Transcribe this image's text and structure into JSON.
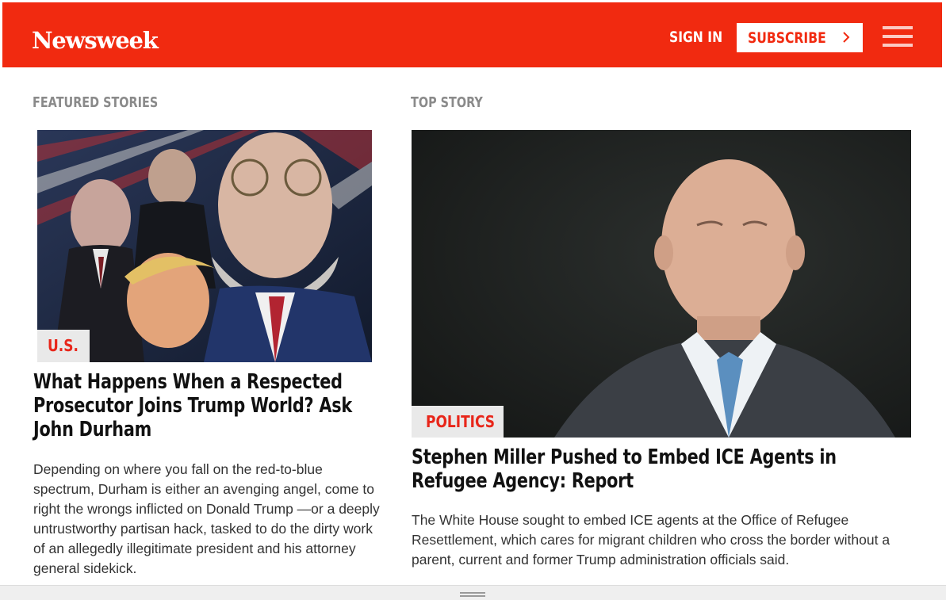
{
  "header": {
    "logo": "Newsweek",
    "sign_in": "SIGN IN",
    "subscribe": "SUBSCRIBE",
    "brand_color": "#f12a10"
  },
  "featured": {
    "section_label": "FEATURED STORIES",
    "tag": "U.S.",
    "headline": "What Happens When a Respected Prosecutor Joins Trump World? Ask John Durham",
    "summary": "Depending on where you fall on the red-to-blue spectrum, Durham is either an avenging angel, come to right the wrongs inflicted on Donald Trump —or a deeply untrustworthy partisan hack, tasked to do the dirty work of an allegedly illegitimate president and his attorney general sidekick."
  },
  "top_story": {
    "section_label": "TOP STORY",
    "tag": "POLITICS",
    "headline": "Stephen Miller Pushed to Embed ICE Agents in Refugee Agency: Report",
    "summary": "The White House sought to embed ICE agents at the Office of Refugee Resettlement, which cares for migrant children who cross the border without a parent, current and former Trump administration officials said."
  }
}
